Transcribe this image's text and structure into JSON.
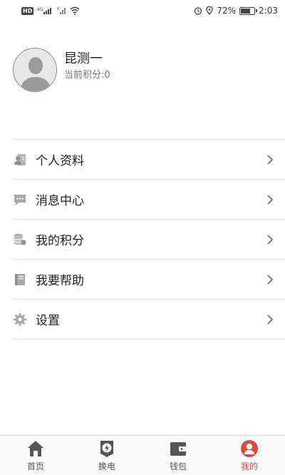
{
  "status_bar": {
    "hd_badge": "HD",
    "network": "4G",
    "battery": "72%",
    "battery_level": 0.72,
    "time": "2:03"
  },
  "profile": {
    "name": "昆测一",
    "points": "当前积分:0"
  },
  "menu": {
    "items": [
      {
        "label": "个人资料",
        "icon": "contact-card-icon"
      },
      {
        "label": "消息中心",
        "icon": "chat-bubble-icon"
      },
      {
        "label": "我的积分",
        "icon": "coin-stack-icon"
      },
      {
        "label": "我要帮助",
        "icon": "book-icon"
      },
      {
        "label": "设置",
        "icon": "gear-icon"
      }
    ]
  },
  "tabs": [
    {
      "label": "首页",
      "icon": "home-icon"
    },
    {
      "label": "换电",
      "icon": "battery-swap-icon"
    },
    {
      "label": "钱包",
      "icon": "wallet-icon"
    },
    {
      "label": "我的",
      "icon": "user-circle-icon",
      "active": true
    }
  ],
  "colors": {
    "accent": "#e04a3a",
    "icon_gray": "#9a9a9a",
    "tab_gray": "#555555"
  }
}
